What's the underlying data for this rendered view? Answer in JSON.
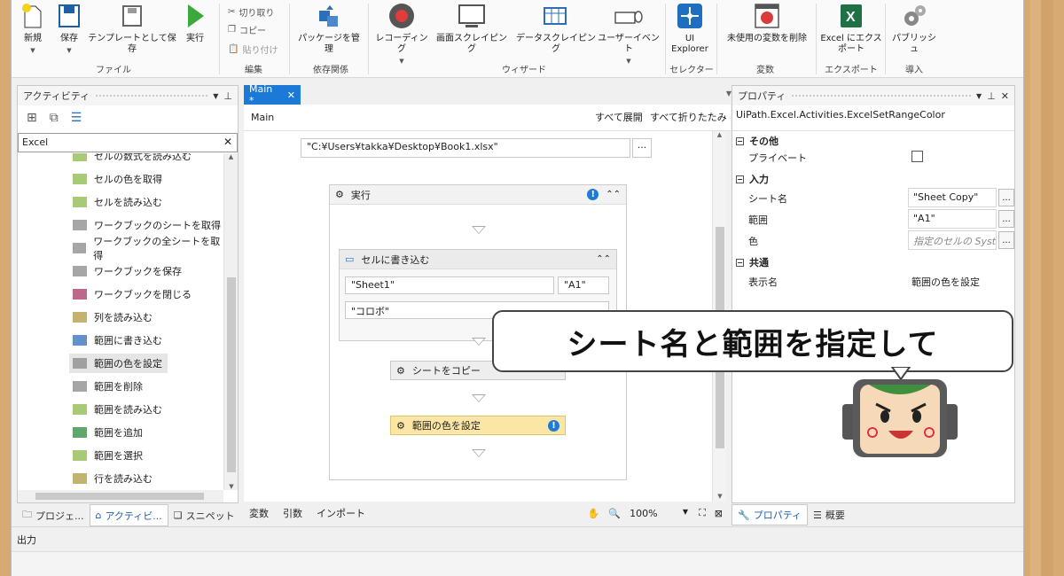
{
  "ribbon": {
    "buttons": [
      {
        "label": "新規"
      },
      {
        "label": "保存"
      },
      {
        "label": "テンプレートとして保存"
      },
      {
        "label": "実行"
      },
      {
        "label": "パッケージを管理"
      },
      {
        "label": "レコーディング"
      },
      {
        "label": "画面スクレイピング"
      },
      {
        "label": "データスクレイピング"
      },
      {
        "label": "ユーザーイベント"
      },
      {
        "label": "UI Explorer"
      },
      {
        "label": "未使用の変数を削除"
      },
      {
        "label": "Excel にエクスポート"
      },
      {
        "label": "パブリッシュ"
      }
    ],
    "small": {
      "cut": "切り取り",
      "copy": "コピー",
      "paste": "貼り付け"
    },
    "groups": {
      "file": "ファイル",
      "edit": "編集",
      "deps": "依存関係",
      "wizard": "ウィザード",
      "selector": "セレクター",
      "vars": "変数",
      "export": "エクスポート",
      "deploy": "導入"
    }
  },
  "activities": {
    "title": "アクティビティ",
    "search": "Excel",
    "items": [
      "セルの数式を読み込む",
      "セルの色を取得",
      "セルを読み込む",
      "ワークブックのシートを取得",
      "ワークブックの全シートを取得",
      "ワークブックを保存",
      "ワークブックを閉じる",
      "列を読み込む",
      "範囲に書き込む",
      "範囲の色を設定",
      "範囲を削除",
      "範囲を読み込む",
      "範囲を追加",
      "範囲を選択",
      "行を読み込む"
    ],
    "bottom_tabs": [
      "プロジェ...",
      "アクティビ...",
      "スニペット"
    ]
  },
  "designer": {
    "tab": "Main *",
    "breadcrumb": "Main",
    "expand_all": "すべて展開",
    "collapse_all": "すべて折りたたみ",
    "path": "\"C:¥Users¥takka¥Desktop¥Book1.xlsx\"",
    "sequence": "実行",
    "write_cell": "セルに書き込む",
    "sheet": "\"Sheet1\"",
    "cell": "\"A1\"",
    "value": "\"コロボ\"",
    "copy_sheet": "シートをコピー",
    "set_color": "範囲の色を設定",
    "footer": {
      "vars": "変数",
      "args": "引数",
      "imports": "インポート",
      "zoom": "100%"
    }
  },
  "properties": {
    "title": "プロパティ",
    "class": "UiPath.Excel.Activities.ExcelSetRangeColor",
    "sections": {
      "misc": "その他",
      "input": "入力",
      "common": "共通"
    },
    "private": "プライベート",
    "sheet_name": {
      "label": "シート名",
      "value": "\"Sheet Copy\""
    },
    "range": {
      "label": "範囲",
      "value": "\"A1\""
    },
    "color": {
      "label": "色",
      "value": "指定のセルの System.Drawing.Color"
    },
    "display": {
      "label": "表示名",
      "value": "範囲の色を設定"
    },
    "bottom_tabs": [
      "プロパティ",
      "概要"
    ]
  },
  "output": "出力",
  "callout": "シート名と範囲を指定して"
}
